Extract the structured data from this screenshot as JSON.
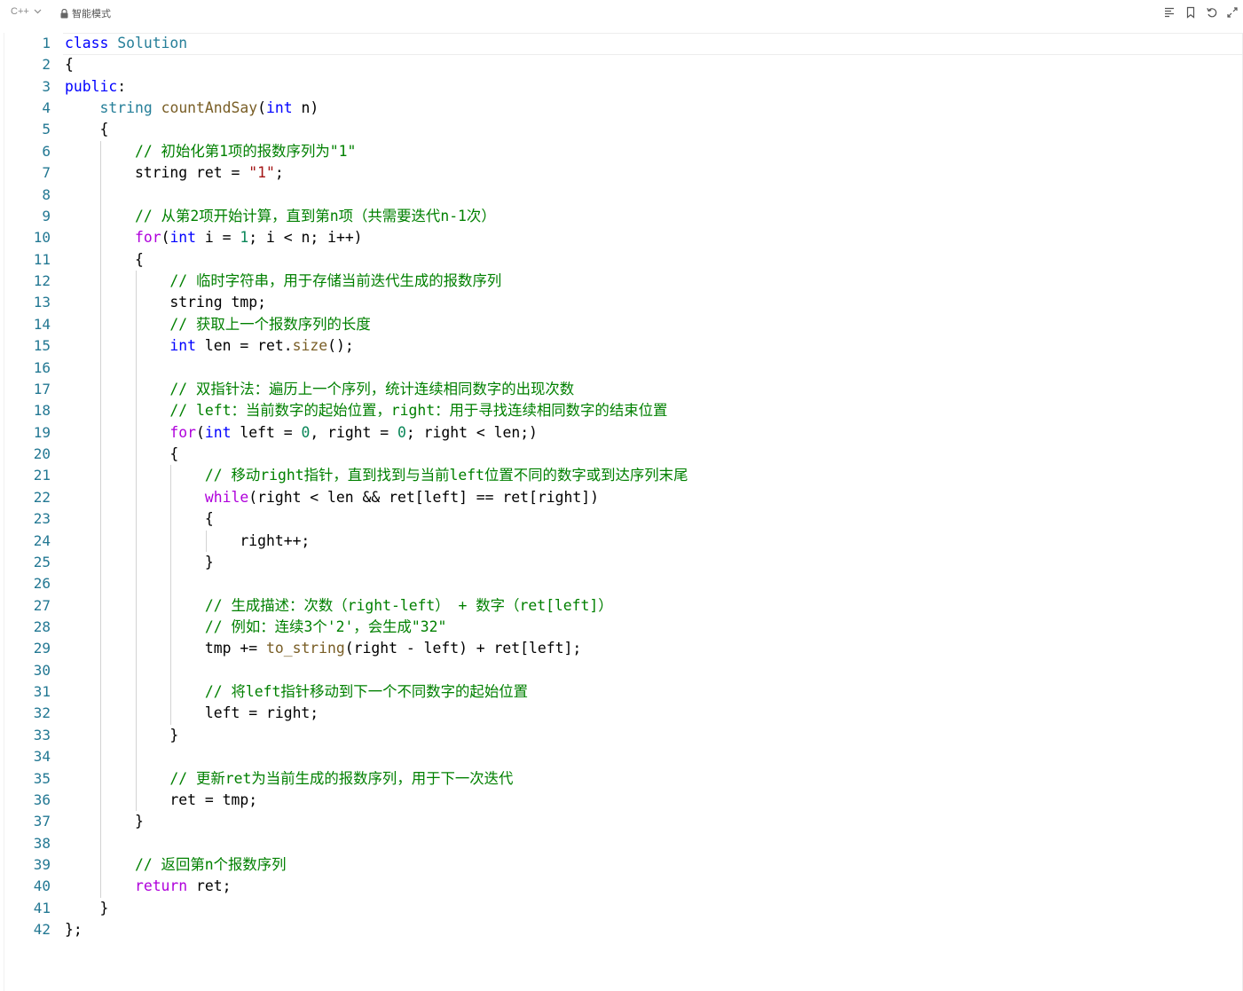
{
  "toolbar": {
    "language": "C++",
    "mode_label": "智能模式"
  },
  "editor": {
    "lines": [
      [
        [
          "kw",
          "class"
        ],
        [
          "p",
          " "
        ],
        [
          "ty",
          "Solution"
        ]
      ],
      [
        [
          "p",
          "{"
        ]
      ],
      [
        [
          "kw",
          "public"
        ],
        [
          "p",
          ":"
        ]
      ],
      [
        [
          "p",
          "    "
        ],
        [
          "ty",
          "string"
        ],
        [
          "p",
          " "
        ],
        [
          "fn",
          "countAndSay"
        ],
        [
          "p",
          "("
        ],
        [
          "kw",
          "int"
        ],
        [
          "p",
          " n)"
        ]
      ],
      [
        [
          "p",
          "    {"
        ]
      ],
      [
        [
          "p",
          "        "
        ],
        [
          "cm",
          "// 初始化第1项的报数序列为\"1\""
        ]
      ],
      [
        [
          "p",
          "        string ret = "
        ],
        [
          "st",
          "\"1\""
        ],
        [
          "p",
          ";"
        ]
      ],
      [],
      [
        [
          "p",
          "        "
        ],
        [
          "cm",
          "// 从第2项开始计算，直到第n项（共需要迭代n-1次）"
        ]
      ],
      [
        [
          "p",
          "        "
        ],
        [
          "kw2",
          "for"
        ],
        [
          "p",
          "("
        ],
        [
          "kw",
          "int"
        ],
        [
          "p",
          " i = "
        ],
        [
          "nm",
          "1"
        ],
        [
          "p",
          "; i < n; i++)"
        ]
      ],
      [
        [
          "p",
          "        {"
        ]
      ],
      [
        [
          "p",
          "            "
        ],
        [
          "cm",
          "// 临时字符串，用于存储当前迭代生成的报数序列"
        ]
      ],
      [
        [
          "p",
          "            string tmp;"
        ]
      ],
      [
        [
          "p",
          "            "
        ],
        [
          "cm",
          "// 获取上一个报数序列的长度"
        ]
      ],
      [
        [
          "p",
          "            "
        ],
        [
          "kw",
          "int"
        ],
        [
          "p",
          " len = ret."
        ],
        [
          "fn",
          "size"
        ],
        [
          "p",
          "();"
        ]
      ],
      [],
      [
        [
          "p",
          "            "
        ],
        [
          "cm",
          "// 双指针法：遍历上一个序列，统计连续相同数字的出现次数"
        ]
      ],
      [
        [
          "p",
          "            "
        ],
        [
          "cm",
          "// left：当前数字的起始位置，right：用于寻找连续相同数字的结束位置"
        ]
      ],
      [
        [
          "p",
          "            "
        ],
        [
          "kw2",
          "for"
        ],
        [
          "p",
          "("
        ],
        [
          "kw",
          "int"
        ],
        [
          "p",
          " left = "
        ],
        [
          "nm",
          "0"
        ],
        [
          "p",
          ", right = "
        ],
        [
          "nm",
          "0"
        ],
        [
          "p",
          "; right < len;)"
        ]
      ],
      [
        [
          "p",
          "            {"
        ]
      ],
      [
        [
          "p",
          "                "
        ],
        [
          "cm",
          "// 移动right指针，直到找到与当前left位置不同的数字或到达序列末尾"
        ]
      ],
      [
        [
          "p",
          "                "
        ],
        [
          "kw2",
          "while"
        ],
        [
          "p",
          "(right < len && ret[left] == ret[right])"
        ]
      ],
      [
        [
          "p",
          "                {"
        ]
      ],
      [
        [
          "p",
          "                    right++;"
        ]
      ],
      [
        [
          "p",
          "                }"
        ]
      ],
      [],
      [
        [
          "p",
          "                "
        ],
        [
          "cm",
          "// 生成描述：次数（right-left） + 数字（ret[left]）"
        ]
      ],
      [
        [
          "p",
          "                "
        ],
        [
          "cm",
          "// 例如：连续3个'2'，会生成\"32\""
        ]
      ],
      [
        [
          "p",
          "                tmp += "
        ],
        [
          "fn",
          "to_string"
        ],
        [
          "p",
          "(right - left) + ret[left];"
        ]
      ],
      [],
      [
        [
          "p",
          "                "
        ],
        [
          "cm",
          "// 将left指针移动到下一个不同数字的起始位置"
        ]
      ],
      [
        [
          "p",
          "                left = right;"
        ]
      ],
      [
        [
          "p",
          "            }"
        ]
      ],
      [],
      [
        [
          "p",
          "            "
        ],
        [
          "cm",
          "// 更新ret为当前生成的报数序列，用于下一次迭代"
        ]
      ],
      [
        [
          "p",
          "            ret = tmp;"
        ]
      ],
      [
        [
          "p",
          "        }"
        ]
      ],
      [],
      [
        [
          "p",
          "        "
        ],
        [
          "cm",
          "// 返回第n个报数序列"
        ]
      ],
      [
        [
          "p",
          "        "
        ],
        [
          "kw2",
          "return"
        ],
        [
          "p",
          " ret;"
        ]
      ],
      [
        [
          "p",
          "    }"
        ]
      ],
      [
        [
          "p",
          "};"
        ]
      ]
    ]
  }
}
